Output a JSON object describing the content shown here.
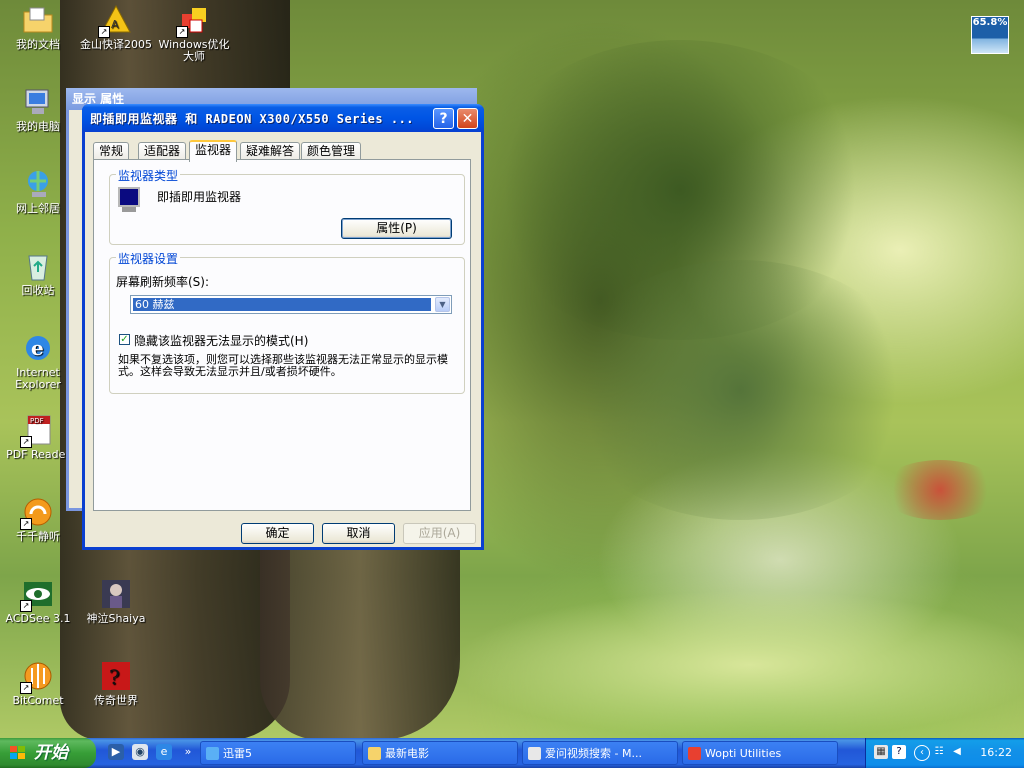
{
  "desktop": {
    "icons": [
      {
        "label": "我的文档",
        "icon": "folder-icon"
      },
      {
        "label": "金山快译2005",
        "icon": "kingsoft-icon"
      },
      {
        "label": "Windows优化大师",
        "icon": "optimizer-icon"
      },
      {
        "label": "我的电脑",
        "icon": "computer-icon"
      },
      {
        "label": "网上邻居",
        "icon": "network-icon"
      },
      {
        "label": "回收站",
        "icon": "recycle-bin-icon"
      },
      {
        "label": "Internet Explorer",
        "icon": "ie-icon"
      },
      {
        "label": "PDF Reader",
        "icon": "pdf-icon"
      },
      {
        "label": "千千静听",
        "icon": "music-player-icon"
      },
      {
        "label": "ACDSee 3.1",
        "icon": "acdsee-icon"
      },
      {
        "label": "神泣Shaiya",
        "icon": "game-icon"
      },
      {
        "label": "BitComet",
        "icon": "bitcomet-icon"
      },
      {
        "label": "传奇世界",
        "icon": "game-red-icon"
      }
    ],
    "meter_value": "65.8%"
  },
  "background_window": {
    "title": "显示 属性"
  },
  "dialog": {
    "title": "即插即用监视器 和 RADEON X300/X550 Series ...",
    "help_button": "?",
    "close_button": "✕",
    "tabs": [
      "常规",
      "适配器",
      "监视器",
      "疑难解答",
      "颜色管理"
    ],
    "active_tab": "监视器",
    "monitor_type": {
      "legend": "监视器类型",
      "name": "即插即用监视器",
      "properties_button": "属性(P)"
    },
    "monitor_settings": {
      "legend": "监视器设置",
      "refresh_label": "屏幕刷新频率(S):",
      "refresh_value": "60 赫兹",
      "hide_modes_label": "隐藏该监视器无法显示的模式(H)",
      "hide_modes_checked": true,
      "description": "如果不复选该项，则您可以选择那些该监视器无法正常显示的显示模式。这样会导致无法显示并且/或者损坏硬件。"
    },
    "buttons": {
      "ok": "确定",
      "cancel": "取消",
      "apply": "应用(A)"
    }
  },
  "taskbar": {
    "start_label": "开始",
    "tasks": [
      {
        "label": "迅雷5",
        "icon": "thunder-icon"
      },
      {
        "label": "最新电影",
        "icon": "folder-icon"
      },
      {
        "label": "爱问视频搜索 - M...",
        "icon": "browser-icon"
      },
      {
        "label": "Wopti Utilities",
        "icon": "optimizer-icon"
      }
    ],
    "clock": "16:22"
  }
}
